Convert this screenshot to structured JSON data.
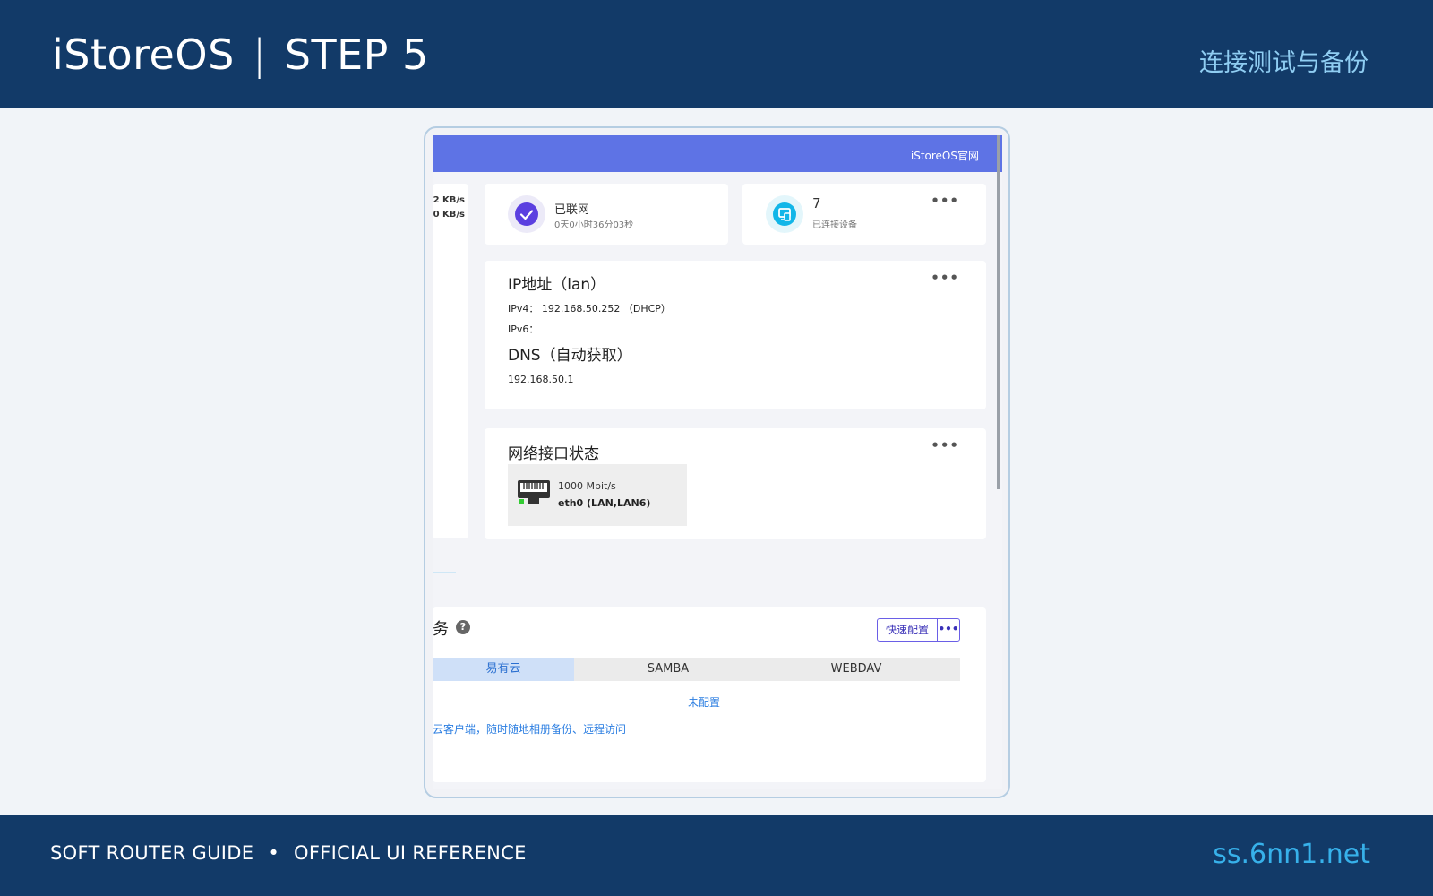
{
  "header": {
    "brand": "iStoreOS",
    "separator": "|",
    "step": "STEP 5",
    "subtitle": "连接测试与备份"
  },
  "footer": {
    "left_a": "SOFT ROUTER GUIDE",
    "dot": "•",
    "left_b": "OFFICIAL UI REFERENCE",
    "site": "ss.6nn1.net"
  },
  "screenshot": {
    "top_link": "iStoreOS官网",
    "left_rates": [
      "2 KB/s",
      "0 KB/s"
    ],
    "network": {
      "status": "已联网",
      "uptime": "0天0小时36分03秒"
    },
    "devices": {
      "count": "7",
      "label": "已连接设备"
    },
    "ip": {
      "title": "IP地址（lan）",
      "ipv4": "IPv4：  192.168.50.252 （DHCP）",
      "ipv6": "IPv6：",
      "dns_title": "DNS（自动获取）",
      "dns_value": "192.168.50.1"
    },
    "interfaces": {
      "title": "网络接口状态",
      "port_speed": "1000 Mbit/s",
      "port_name": "eth0 (LAN,LAN6)"
    },
    "services": {
      "title": "务",
      "help": "?",
      "quick_config": "快速配置",
      "more": "•••",
      "tabs": [
        "易有云",
        "SAMBA",
        "WEBDAV"
      ],
      "status": "未配置",
      "description": "云客户端，随时随地相册备份、远程访问"
    },
    "more_icon": "•••",
    "colors": {
      "accent_header": "#5e73e5",
      "page_bars": "#123a68",
      "link": "#2a7de1"
    }
  }
}
